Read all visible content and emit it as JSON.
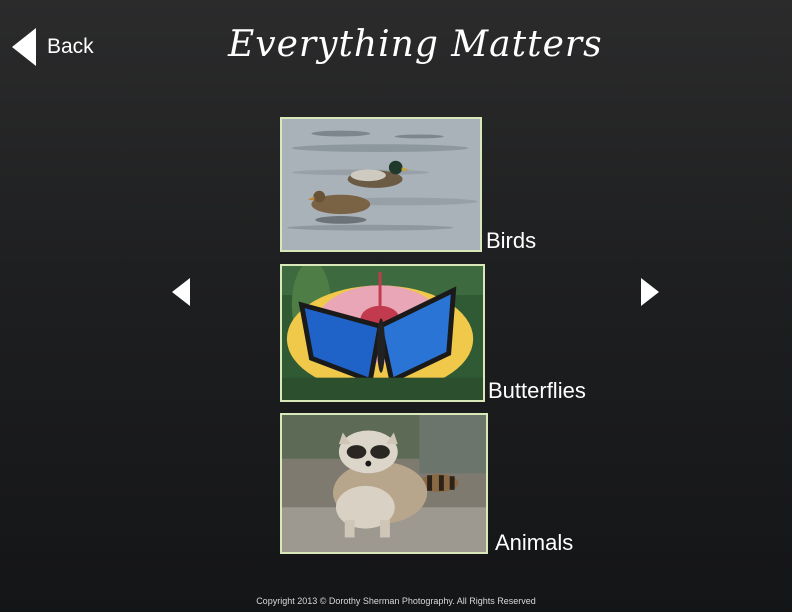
{
  "header": {
    "back_label": "Back",
    "title": "Everything Matters"
  },
  "icons": {
    "back": "back-triangle-icon",
    "prev": "left-arrow-icon",
    "next": "right-arrow-icon"
  },
  "categories": [
    {
      "label": "Birds",
      "image": "ducks-swimming-photo"
    },
    {
      "label": "Butterflies",
      "image": "blue-butterfly-on-hibiscus-photo"
    },
    {
      "label": "Animals",
      "image": "raccoon-photo"
    }
  ],
  "footer": {
    "copyright": "Copyright 2013 © Dorothy Sherman Photography. All Rights Reserved"
  },
  "colors": {
    "background": "#1e1f20",
    "thumb_border": "#d8e8b8",
    "text": "#ffffff"
  }
}
